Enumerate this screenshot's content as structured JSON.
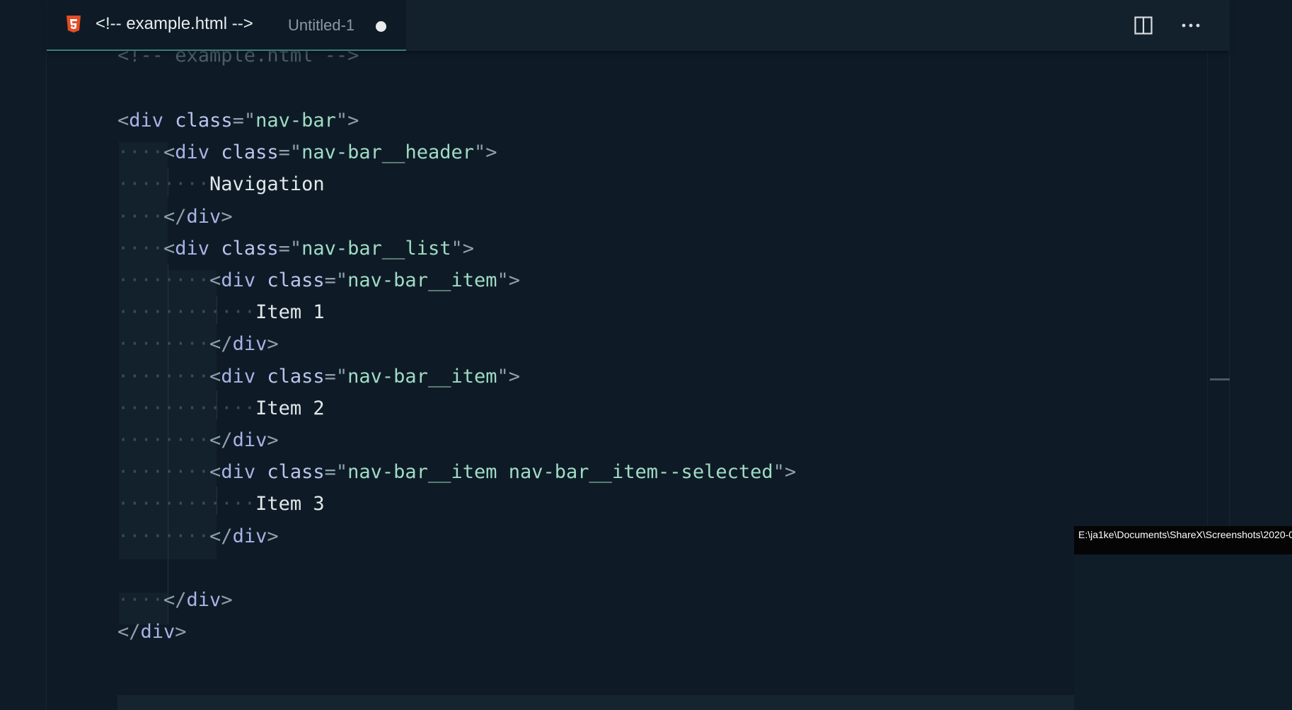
{
  "tab": {
    "icon": "html5-icon",
    "title": "<!-- example.html -->",
    "description": "Untitled-1",
    "dirty_indicator": "unsaved-dot"
  },
  "toolbar": {
    "split_icon": "split-editor-icon",
    "more_icon": "more-actions-icon"
  },
  "colors": {
    "background": "#0e1b26",
    "tag": "#a7b3e6",
    "string": "#9fdcc5",
    "text": "#e2e7ea",
    "comment": "#4c5d69",
    "html_icon": "#e44d26"
  },
  "code": {
    "comment": "<!-- example.html -->",
    "lines": [
      {
        "ws": "",
        "open": "<",
        "tag": "div",
        "attr": " class",
        "eq": "=\"",
        "val": "nav-bar",
        "close": "\">"
      },
      {
        "ws": "····",
        "open": "<",
        "tag": "div",
        "attr": " class",
        "eq": "=\"",
        "val": "nav-bar__header",
        "close": "\">"
      },
      {
        "ws": "········",
        "text": "Navigation"
      },
      {
        "ws": "····",
        "open": "</",
        "tag": "div",
        "close": ">"
      },
      {
        "ws": "····",
        "open": "<",
        "tag": "div",
        "attr": " class",
        "eq": "=\"",
        "val": "nav-bar__list",
        "close": "\">"
      },
      {
        "ws": "········",
        "open": "<",
        "tag": "div",
        "attr": " class",
        "eq": "=\"",
        "val": "nav-bar__item",
        "close": "\">"
      },
      {
        "ws": "············",
        "text": "Item 1"
      },
      {
        "ws": "········",
        "open": "</",
        "tag": "div",
        "close": ">"
      },
      {
        "ws": "········",
        "open": "<",
        "tag": "div",
        "attr": " class",
        "eq": "=\"",
        "val": "nav-bar__item",
        "close": "\">"
      },
      {
        "ws": "············",
        "text": "Item 2"
      },
      {
        "ws": "········",
        "open": "</",
        "tag": "div",
        "close": ">"
      },
      {
        "ws": "········",
        "open": "<",
        "tag": "div",
        "attr": " class",
        "eq": "=\"",
        "val": "nav-bar__item nav-bar__item--selected",
        "close": "\">"
      },
      {
        "ws": "············",
        "text": "Item 3"
      },
      {
        "ws": "········",
        "open": "</",
        "tag": "div",
        "close": ">"
      },
      {
        "ws": ""
      },
      {
        "ws": "····",
        "open": "</",
        "tag": "div",
        "close": ">"
      },
      {
        "ws": "",
        "open": "</",
        "tag": "div",
        "close": ">"
      }
    ]
  },
  "tooltip": {
    "text": "E:\\ja1ke\\Documents\\ShareX\\Screenshots\\2020-0"
  }
}
